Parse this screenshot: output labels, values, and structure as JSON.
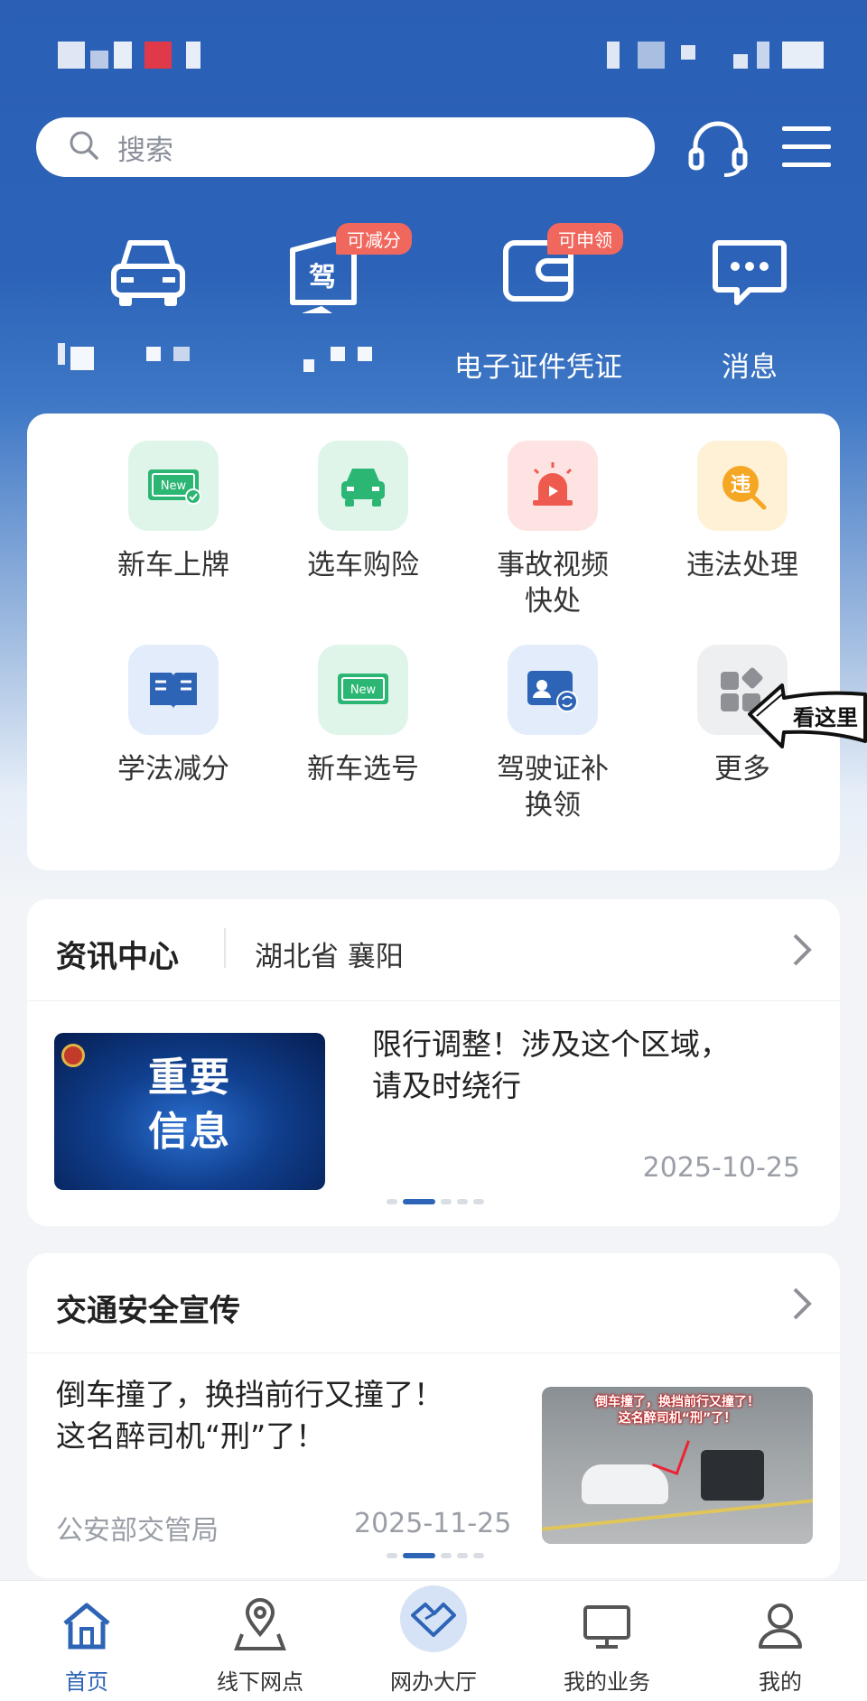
{
  "search": {
    "placeholder": "搜索"
  },
  "quick_actions": [
    {
      "icon": "car-icon",
      "label": "",
      "badge": ""
    },
    {
      "icon": "license-icon",
      "label": "",
      "badge": "可减分"
    },
    {
      "icon": "wallet-icon",
      "label": "电子证件凭证",
      "badge": "可申领"
    },
    {
      "icon": "message-icon",
      "label": "消息",
      "badge": ""
    }
  ],
  "services": [
    {
      "icon": "new-plate-icon",
      "label": "新车上牌"
    },
    {
      "icon": "car-insurance-icon",
      "label": "选车购险"
    },
    {
      "icon": "alarm-icon",
      "label": "事故视频\n快处"
    },
    {
      "icon": "violation-icon",
      "label": "违法处理"
    },
    {
      "icon": "book-icon",
      "label": "学法减分"
    },
    {
      "icon": "new-number-icon",
      "label": "新车选号"
    },
    {
      "icon": "id-card-icon",
      "label": "驾驶证补\n换领"
    },
    {
      "icon": "more-icon",
      "label": "更多"
    }
  ],
  "annotation": {
    "text": "看这里"
  },
  "news": {
    "title": "资讯中心",
    "region": "湖北省 襄阳",
    "thumb_text": "重要\n信息",
    "headline": "限行调整！涉及这个区域，\n请及时绕行",
    "date": "2025-10-25"
  },
  "safety": {
    "title": "交通安全宣传",
    "headline": "倒车撞了，换挡前行又撞了！\n这名醉司机“刑”了！",
    "source": "公安部交管局",
    "date": "2025-11-25",
    "thumb_caption": "倒车撞了，换挡前行又撞了！\n这名醉司机“刑”了！"
  },
  "tabs": [
    {
      "icon": "home-icon",
      "label": "首页",
      "active": true
    },
    {
      "icon": "location-icon",
      "label": "线下网点",
      "active": false
    },
    {
      "icon": "handshake-icon",
      "label": "网办大厅",
      "active": false
    },
    {
      "icon": "monitor-icon",
      "label": "我的业务",
      "active": false
    },
    {
      "icon": "user-icon",
      "label": "我的",
      "active": false
    }
  ],
  "colors": {
    "brand": "#2c63b8",
    "accent": "#2d64b6",
    "badge": "#f0675d"
  }
}
